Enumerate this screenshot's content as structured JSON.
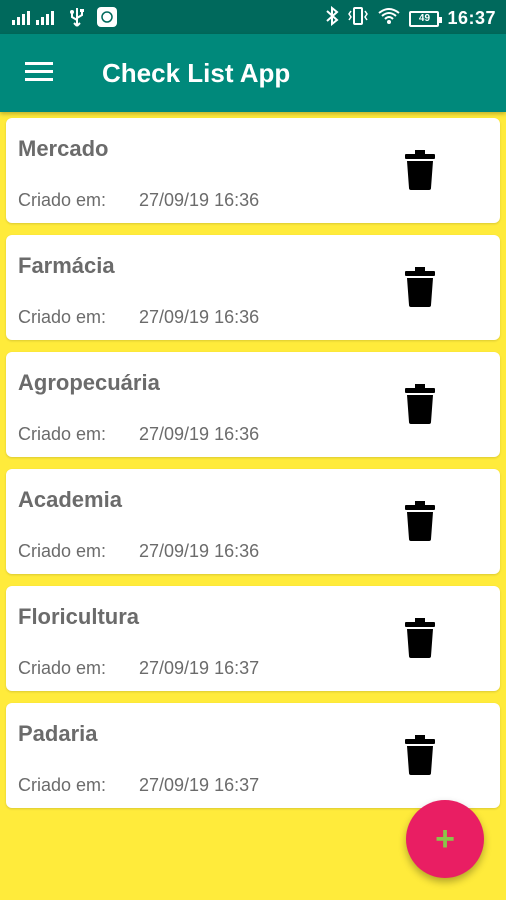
{
  "status_bar": {
    "time": "16:37",
    "battery": "49"
  },
  "app_bar": {
    "title": "Check List App"
  },
  "lists": [
    {
      "name": "Mercado",
      "created_label": "Criado em:",
      "created_at": "27/09/19 16:36"
    },
    {
      "name": "Farmácia",
      "created_label": "Criado em:",
      "created_at": "27/09/19 16:36"
    },
    {
      "name": "Agropecuária",
      "created_label": "Criado em:",
      "created_at": "27/09/19 16:36"
    },
    {
      "name": "Academia",
      "created_label": "Criado em:",
      "created_at": "27/09/19 16:36"
    },
    {
      "name": "Floricultura",
      "created_label": "Criado em:",
      "created_at": "27/09/19 16:37"
    },
    {
      "name": "Padaria",
      "created_label": "Criado em:",
      "created_at": "27/09/19 16:37"
    }
  ],
  "fab": {
    "icon": "plus-icon",
    "label": "+"
  },
  "colors": {
    "status_bar": "#00695C",
    "app_bar": "#00897B",
    "background": "#FFEB3B",
    "fab": "#E91E63",
    "fab_icon": "#8BC34A"
  }
}
